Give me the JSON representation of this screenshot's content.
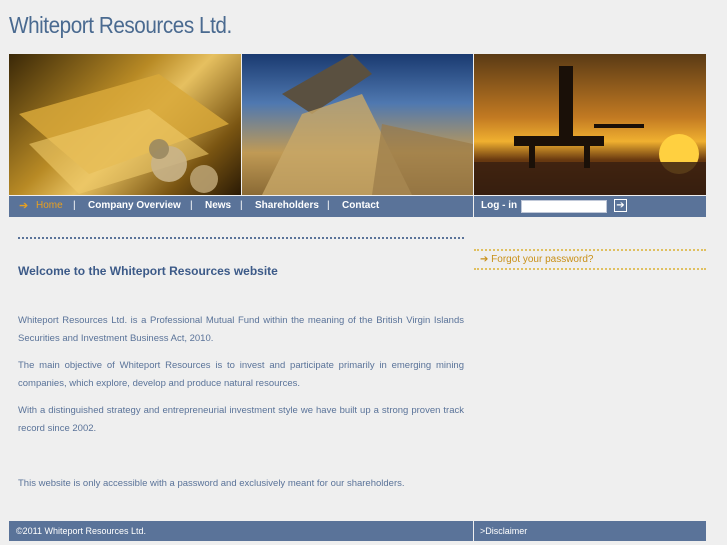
{
  "site_title": "Whiteport Resources Ltd.",
  "nav": {
    "items": [
      {
        "label": "Home"
      },
      {
        "label": "Company Overview"
      },
      {
        "label": "News"
      },
      {
        "label": "Shareholders"
      },
      {
        "label": "Contact"
      }
    ],
    "separator": "|",
    "arrow": "➔"
  },
  "login": {
    "label": "Log - in",
    "input_value": "",
    "go_icon": "arrow-right-box-icon"
  },
  "main": {
    "heading": "Welcome to the Whiteport Resources website",
    "paragraphs": [
      "Whiteport Resources Ltd. is a Professional Mutual Fund within the meaning of the British Virgin Islands Securities and Investment Business Act, 2010.",
      "The main objective of Whiteport Resources is to invest and participate primarily in emerging mining companies, which explore, develop and produce natural resources.",
      "With a distinguished strategy and entrepreneurial investment style we have built up a strong proven track record since 2002.",
      "This website is only accessible with a password and exclusively meant for our shareholders."
    ]
  },
  "sidebar": {
    "forgot_password": "Forgot your password?"
  },
  "footer": {
    "copyright": "©2011 Whiteport Resources Ltd.",
    "disclaimer": ">Disclaimer"
  },
  "colors": {
    "bar": "#5a7399",
    "accent": "#e8a020",
    "title": "#4a6a90"
  }
}
